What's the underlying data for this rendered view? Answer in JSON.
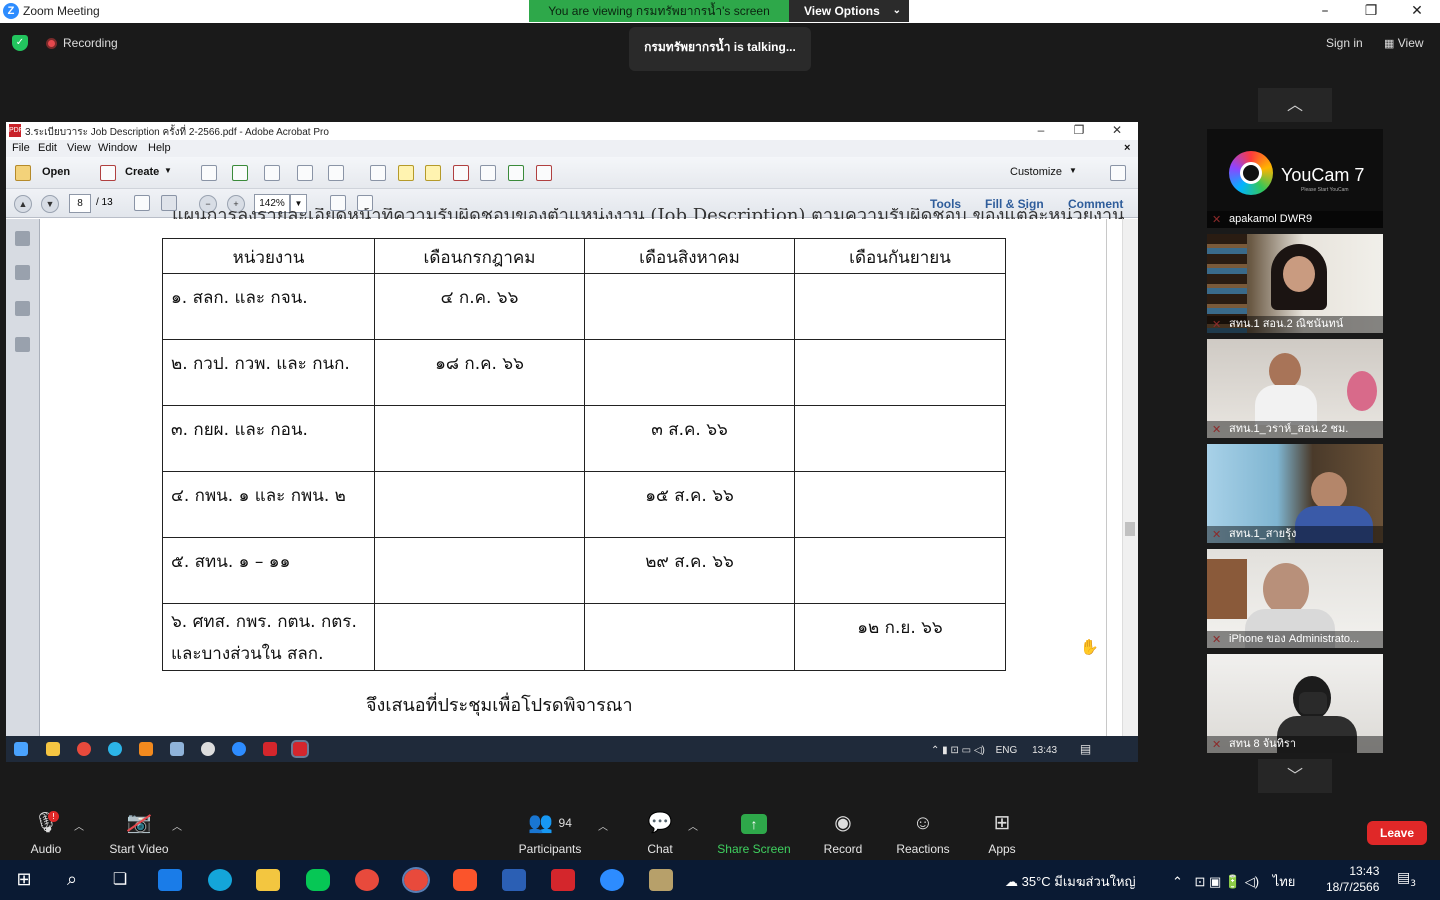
{
  "window": {
    "title": "Zoom Meeting",
    "logo_letter": "Z"
  },
  "share_banner": {
    "text": "You are viewing กรมทรัพยากรน้ำ's screen",
    "view_options": "View Options"
  },
  "talking": "กรมทรัพยากรน้ำ is talking...",
  "recording_label": "Recording",
  "top_right": {
    "sign_in": "Sign in",
    "view": "View"
  },
  "acrobat": {
    "title": "3.ระเบียบวาระ Job Description ครั้งที่ 2-2566.pdf - Adobe Acrobat Pro",
    "menu": [
      "File",
      "Edit",
      "View",
      "Window",
      "Help"
    ],
    "open_label": "Open",
    "create_label": "Create",
    "customize_label": "Customize",
    "page_current": "8",
    "page_total": "/ 13",
    "zoom": "142%",
    "right_links": {
      "tools": "Tools",
      "fill_sign": "Fill & Sign",
      "comment": "Comment"
    }
  },
  "document": {
    "cut_heading": "แผนการลงรายละเอียดหน้าที่ความรับผิดชอบของตำแหน่งงาน (Job Description) ตามความรับผิดชอบ ของแต่ละหน่วยงาน",
    "headers": [
      "หน่วยงาน",
      "เดือนกรกฎาคม",
      "เดือนสิงหาคม",
      "เดือนกันยายน"
    ],
    "rows": [
      {
        "unit": "๑. สลก. และ กจน.",
        "jul": "๔ ก.ค. ๖๖",
        "aug": "",
        "sep": ""
      },
      {
        "unit": "๒. กวป. กวพ. และ กนก.",
        "jul": "๑๘ ก.ค. ๖๖",
        "aug": "",
        "sep": ""
      },
      {
        "unit": "๓. กยผ. และ กอน.",
        "jul": "",
        "aug": "๓ ส.ค. ๖๖",
        "sep": ""
      },
      {
        "unit": "๔. กพน. ๑ และ กพน. ๒",
        "jul": "",
        "aug": "๑๕ ส.ค. ๖๖",
        "sep": ""
      },
      {
        "unit": "๕. สทน. ๑ – ๑๑",
        "jul": "",
        "aug": "๒๙ ส.ค. ๖๖",
        "sep": ""
      },
      {
        "unit": "๖. ศทส. กพร. กตน. กตร.",
        "unit2": "และบางส่วนใน สลก.",
        "jul": "",
        "aug": "",
        "sep": "๑๒ ก.ย. ๖๖"
      }
    ],
    "propose": "จึงเสนอที่ประชุมเพื่อโปรดพิจารณา"
  },
  "inner_tray": {
    "lang": "ENG",
    "time": "13:43"
  },
  "gallery": [
    {
      "name": "apakamol DWR9",
      "brand": "YouCam 7",
      "tagline": "Please Start YouCam"
    },
    {
      "name": "สทน.1 สอน.2 ณิชนันทน์"
    },
    {
      "name": "สทน.1_วราห์_สอน.2 ชม."
    },
    {
      "name": "สทน.1_สายรุ้ง"
    },
    {
      "name": "iPhone ของ Administrato..."
    },
    {
      "name": "สทน 8  จันทิรา"
    }
  ],
  "controls": {
    "audio": "Audio",
    "start_video": "Start Video",
    "participants": "Participants",
    "participants_count": "94",
    "chat": "Chat",
    "share_screen": "Share Screen",
    "record": "Record",
    "reactions": "Reactions",
    "apps": "Apps",
    "leave": "Leave",
    "mic_badge": "!"
  },
  "taskbar": {
    "weather": "35°C  มีเมฆส่วนใหญ่",
    "lang": "ไทย",
    "time": "13:43",
    "date": "18/7/2566",
    "notif_count": "3"
  },
  "colors": {
    "zoom_blue": "#2d8cff",
    "share_green": "#2ea84a",
    "leave_red": "#e02828"
  }
}
